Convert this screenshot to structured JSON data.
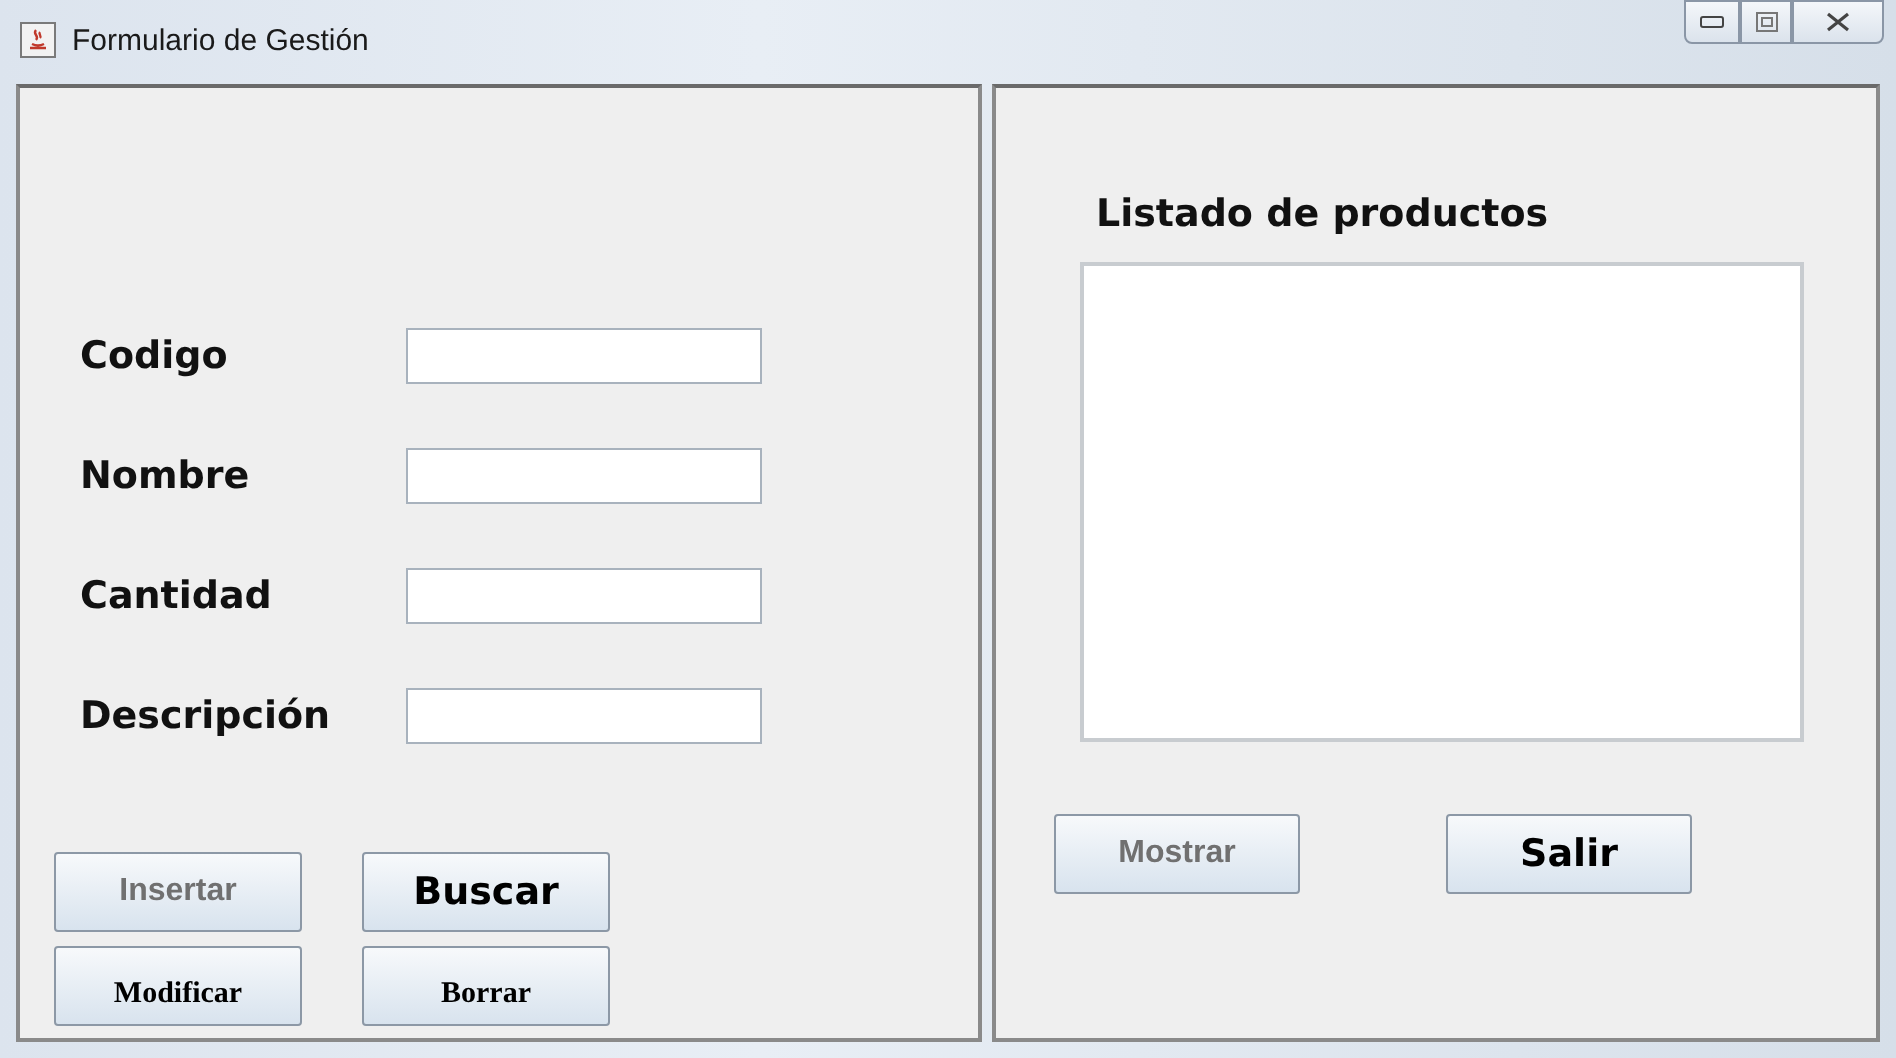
{
  "window": {
    "title": "Formulario de Gestión"
  },
  "form": {
    "fields": [
      {
        "label": "Codigo"
      },
      {
        "label": "Nombre"
      },
      {
        "label": "Cantidad"
      },
      {
        "label": "Descripción"
      }
    ],
    "buttons": [
      {
        "label": "Insertar",
        "kind": "plain"
      },
      {
        "label": "Buscar",
        "kind": "large"
      },
      {
        "label": "Modificar",
        "kind": "serif"
      },
      {
        "label": "Borrar",
        "kind": "serif"
      }
    ]
  },
  "list_panel": {
    "title": "Listado de productos",
    "buttons": [
      {
        "label": "Mostrar",
        "kind": "plain"
      },
      {
        "label": "Salir",
        "kind": "large"
      }
    ]
  }
}
